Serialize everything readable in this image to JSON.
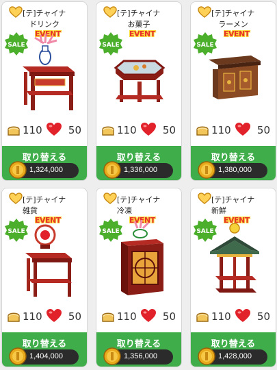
{
  "common": {
    "badge_event": "EVENT",
    "badge_sale": "SALE",
    "exchange_label": "取り替える",
    "stat_bread": "110",
    "stat_heart": "50"
  },
  "cards": [
    {
      "title": "[テ]チャイナ",
      "subtitle": "ドリンク",
      "price": "1,324,000",
      "item_icon": "drink-table-icon"
    },
    {
      "title": "[テ]チャイナ",
      "subtitle": "お菓子",
      "price": "1,336,000",
      "item_icon": "sweets-table-icon"
    },
    {
      "title": "[テ]チャイナ",
      "subtitle": "ラーメン",
      "price": "1,380,000",
      "item_icon": "ramen-cabinet-icon"
    },
    {
      "title": "[テ]チャイナ",
      "subtitle": "雑貨",
      "price": "1,404,000",
      "item_icon": "goods-stand-icon"
    },
    {
      "title": "[テ]チャイナ",
      "subtitle": "冷凍",
      "price": "1,356,000",
      "item_icon": "freezer-cabinet-icon"
    },
    {
      "title": "[テ]チャイナ",
      "subtitle": "新鮮",
      "price": "1,428,000",
      "item_icon": "pagoda-stand-icon"
    }
  ],
  "colors": {
    "button_green": "#3fae4a",
    "price_bg": "#2b2b2b",
    "event_red": "#e53329",
    "sale_green": "#4caf2c"
  }
}
